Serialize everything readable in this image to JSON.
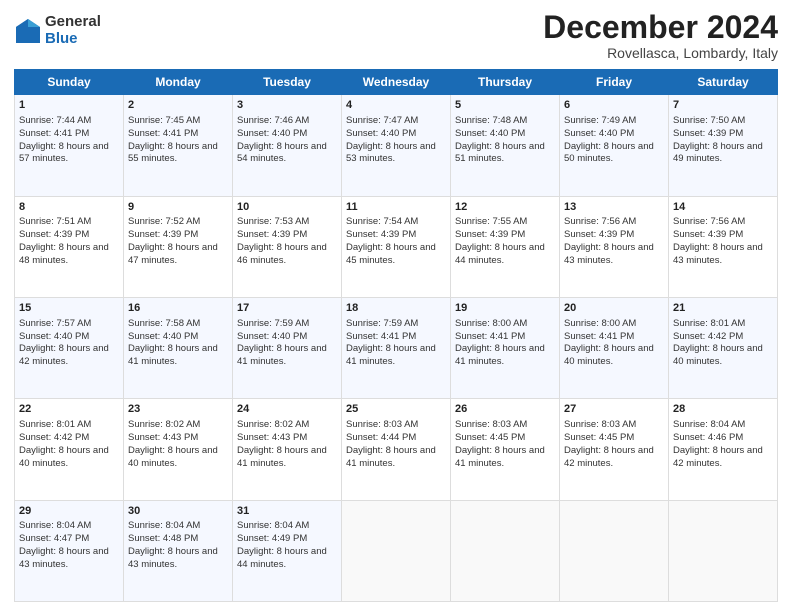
{
  "logo": {
    "general": "General",
    "blue": "Blue"
  },
  "title": "December 2024",
  "location": "Rovellasca, Lombardy, Italy",
  "days_of_week": [
    "Sunday",
    "Monday",
    "Tuesday",
    "Wednesday",
    "Thursday",
    "Friday",
    "Saturday"
  ],
  "weeks": [
    [
      {
        "day": "1",
        "sunrise": "Sunrise: 7:44 AM",
        "sunset": "Sunset: 4:41 PM",
        "daylight": "Daylight: 8 hours and 57 minutes."
      },
      {
        "day": "2",
        "sunrise": "Sunrise: 7:45 AM",
        "sunset": "Sunset: 4:41 PM",
        "daylight": "Daylight: 8 hours and 55 minutes."
      },
      {
        "day": "3",
        "sunrise": "Sunrise: 7:46 AM",
        "sunset": "Sunset: 4:40 PM",
        "daylight": "Daylight: 8 hours and 54 minutes."
      },
      {
        "day": "4",
        "sunrise": "Sunrise: 7:47 AM",
        "sunset": "Sunset: 4:40 PM",
        "daylight": "Daylight: 8 hours and 53 minutes."
      },
      {
        "day": "5",
        "sunrise": "Sunrise: 7:48 AM",
        "sunset": "Sunset: 4:40 PM",
        "daylight": "Daylight: 8 hours and 51 minutes."
      },
      {
        "day": "6",
        "sunrise": "Sunrise: 7:49 AM",
        "sunset": "Sunset: 4:40 PM",
        "daylight": "Daylight: 8 hours and 50 minutes."
      },
      {
        "day": "7",
        "sunrise": "Sunrise: 7:50 AM",
        "sunset": "Sunset: 4:39 PM",
        "daylight": "Daylight: 8 hours and 49 minutes."
      }
    ],
    [
      {
        "day": "8",
        "sunrise": "Sunrise: 7:51 AM",
        "sunset": "Sunset: 4:39 PM",
        "daylight": "Daylight: 8 hours and 48 minutes."
      },
      {
        "day": "9",
        "sunrise": "Sunrise: 7:52 AM",
        "sunset": "Sunset: 4:39 PM",
        "daylight": "Daylight: 8 hours and 47 minutes."
      },
      {
        "day": "10",
        "sunrise": "Sunrise: 7:53 AM",
        "sunset": "Sunset: 4:39 PM",
        "daylight": "Daylight: 8 hours and 46 minutes."
      },
      {
        "day": "11",
        "sunrise": "Sunrise: 7:54 AM",
        "sunset": "Sunset: 4:39 PM",
        "daylight": "Daylight: 8 hours and 45 minutes."
      },
      {
        "day": "12",
        "sunrise": "Sunrise: 7:55 AM",
        "sunset": "Sunset: 4:39 PM",
        "daylight": "Daylight: 8 hours and 44 minutes."
      },
      {
        "day": "13",
        "sunrise": "Sunrise: 7:56 AM",
        "sunset": "Sunset: 4:39 PM",
        "daylight": "Daylight: 8 hours and 43 minutes."
      },
      {
        "day": "14",
        "sunrise": "Sunrise: 7:56 AM",
        "sunset": "Sunset: 4:39 PM",
        "daylight": "Daylight: 8 hours and 43 minutes."
      }
    ],
    [
      {
        "day": "15",
        "sunrise": "Sunrise: 7:57 AM",
        "sunset": "Sunset: 4:40 PM",
        "daylight": "Daylight: 8 hours and 42 minutes."
      },
      {
        "day": "16",
        "sunrise": "Sunrise: 7:58 AM",
        "sunset": "Sunset: 4:40 PM",
        "daylight": "Daylight: 8 hours and 41 minutes."
      },
      {
        "day": "17",
        "sunrise": "Sunrise: 7:59 AM",
        "sunset": "Sunset: 4:40 PM",
        "daylight": "Daylight: 8 hours and 41 minutes."
      },
      {
        "day": "18",
        "sunrise": "Sunrise: 7:59 AM",
        "sunset": "Sunset: 4:41 PM",
        "daylight": "Daylight: 8 hours and 41 minutes."
      },
      {
        "day": "19",
        "sunrise": "Sunrise: 8:00 AM",
        "sunset": "Sunset: 4:41 PM",
        "daylight": "Daylight: 8 hours and 41 minutes."
      },
      {
        "day": "20",
        "sunrise": "Sunrise: 8:00 AM",
        "sunset": "Sunset: 4:41 PM",
        "daylight": "Daylight: 8 hours and 40 minutes."
      },
      {
        "day": "21",
        "sunrise": "Sunrise: 8:01 AM",
        "sunset": "Sunset: 4:42 PM",
        "daylight": "Daylight: 8 hours and 40 minutes."
      }
    ],
    [
      {
        "day": "22",
        "sunrise": "Sunrise: 8:01 AM",
        "sunset": "Sunset: 4:42 PM",
        "daylight": "Daylight: 8 hours and 40 minutes."
      },
      {
        "day": "23",
        "sunrise": "Sunrise: 8:02 AM",
        "sunset": "Sunset: 4:43 PM",
        "daylight": "Daylight: 8 hours and 40 minutes."
      },
      {
        "day": "24",
        "sunrise": "Sunrise: 8:02 AM",
        "sunset": "Sunset: 4:43 PM",
        "daylight": "Daylight: 8 hours and 41 minutes."
      },
      {
        "day": "25",
        "sunrise": "Sunrise: 8:03 AM",
        "sunset": "Sunset: 4:44 PM",
        "daylight": "Daylight: 8 hours and 41 minutes."
      },
      {
        "day": "26",
        "sunrise": "Sunrise: 8:03 AM",
        "sunset": "Sunset: 4:45 PM",
        "daylight": "Daylight: 8 hours and 41 minutes."
      },
      {
        "day": "27",
        "sunrise": "Sunrise: 8:03 AM",
        "sunset": "Sunset: 4:45 PM",
        "daylight": "Daylight: 8 hours and 42 minutes."
      },
      {
        "day": "28",
        "sunrise": "Sunrise: 8:04 AM",
        "sunset": "Sunset: 4:46 PM",
        "daylight": "Daylight: 8 hours and 42 minutes."
      }
    ],
    [
      {
        "day": "29",
        "sunrise": "Sunrise: 8:04 AM",
        "sunset": "Sunset: 4:47 PM",
        "daylight": "Daylight: 8 hours and 43 minutes."
      },
      {
        "day": "30",
        "sunrise": "Sunrise: 8:04 AM",
        "sunset": "Sunset: 4:48 PM",
        "daylight": "Daylight: 8 hours and 43 minutes."
      },
      {
        "day": "31",
        "sunrise": "Sunrise: 8:04 AM",
        "sunset": "Sunset: 4:49 PM",
        "daylight": "Daylight: 8 hours and 44 minutes."
      },
      null,
      null,
      null,
      null
    ]
  ]
}
